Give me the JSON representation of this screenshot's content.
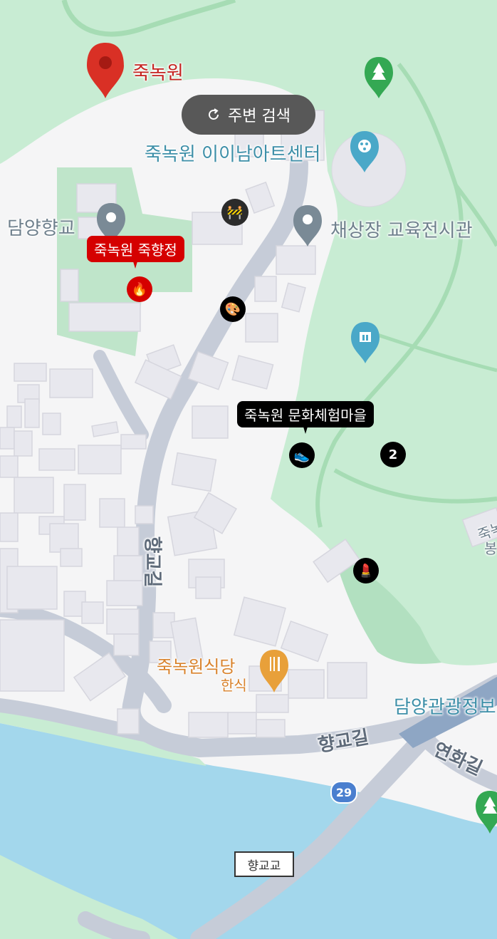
{
  "search_button": {
    "label": "주변 검색",
    "icon": "refresh-icon"
  },
  "places": {
    "juknokwon": "죽녹원",
    "art_center": "죽녹원 이이남아트센터",
    "hyanggyo": "담양향교",
    "chaesangjang": "채상장 교육전시관",
    "restaurant": "죽녹원식당",
    "restaurant_category": "한식",
    "tourist_info": "담양관광정보",
    "east_edge_1": "죽녹",
    "east_edge_2": "봉"
  },
  "tags": {
    "juk_hyangjeong": "죽녹원 죽향정",
    "culture_village": "죽녹원 문화체험마을"
  },
  "markers": {
    "cluster_count": "2",
    "fire": "🔥",
    "palette": "🎨",
    "shoe": "👟",
    "lipstick": "💄",
    "construction": "🚧"
  },
  "roads": {
    "hyanggyo_gil_vertical": "향교길",
    "hyanggyo_gil_horizontal": "향교길",
    "yeonhwa_gil": "연화길",
    "route_shield": "29",
    "bridge": "향교교"
  },
  "colors": {
    "park": "#c8ecd3",
    "river": "#a3d7ec",
    "road": "#c6ccd8",
    "building": "#e8e8ee",
    "red_pin": "#d93025",
    "teal_pin": "#4aa8c8",
    "gray_pin": "#7a8a96",
    "green_pin": "#34a853",
    "orange_pin": "#e8a03a"
  }
}
